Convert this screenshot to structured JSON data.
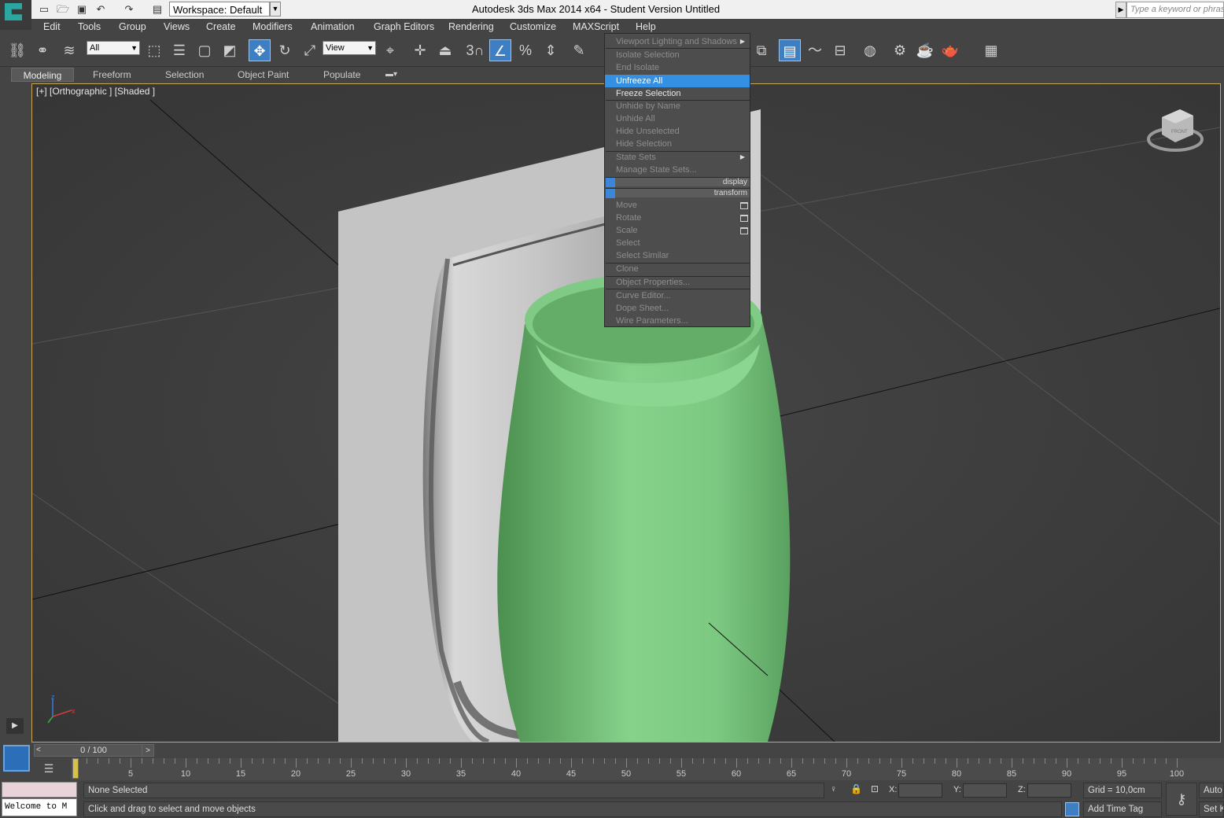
{
  "app": {
    "title": "Autodesk 3ds Max  2014 x64  - Student Version    Untitled",
    "workspace": "Workspace: Default",
    "search_placeholder": "Type a keyword or phrase"
  },
  "menubar": [
    "Edit",
    "Tools",
    "Group",
    "Views",
    "Create",
    "Modifiers",
    "Animation",
    "Graph Editors",
    "Rendering",
    "Customize",
    "MAXScript",
    "Help"
  ],
  "toolbar": {
    "selection_filter": "All",
    "ref_coord": "View",
    "snap_label": "3"
  },
  "ribbon_tabs": [
    "Modeling",
    "Freeform",
    "Selection",
    "Object Paint",
    "Populate"
  ],
  "viewport": {
    "label": "[+] [Orthographic ] [Shaded ]",
    "viewcube_label": "FRONT",
    "axis_labels": {
      "z": "z",
      "x": "x",
      "y": "y"
    }
  },
  "context_menu": {
    "items": [
      {
        "label": "Viewport Lighting and Shadows",
        "state": "disabled",
        "submenu": true
      },
      {
        "label": "Isolate Selection",
        "state": "disabled"
      },
      {
        "label": "End Isolate",
        "state": "disabled"
      },
      {
        "label": "Unfreeze All",
        "state": "selected"
      },
      {
        "label": "Freeze Selection",
        "state": "enabled"
      },
      {
        "label": "Unhide by Name",
        "state": "disabled"
      },
      {
        "label": "Unhide All",
        "state": "disabled"
      },
      {
        "label": "Hide Unselected",
        "state": "disabled"
      },
      {
        "label": "Hide Selection",
        "state": "disabled"
      },
      {
        "label": "State Sets",
        "state": "disabled",
        "submenu": true
      },
      {
        "label": "Manage State Sets...",
        "state": "disabled"
      },
      {
        "label": "Move",
        "state": "disabled"
      },
      {
        "label": "Rotate",
        "state": "disabled"
      },
      {
        "label": "Scale",
        "state": "disabled"
      },
      {
        "label": "Select",
        "state": "disabled"
      },
      {
        "label": "Select Similar",
        "state": "disabled"
      },
      {
        "label": "Clone",
        "state": "disabled"
      },
      {
        "label": "Object Properties...",
        "state": "disabled"
      },
      {
        "label": "Curve Editor...",
        "state": "disabled"
      },
      {
        "label": "Dope Sheet...",
        "state": "disabled"
      },
      {
        "label": "Wire Parameters...",
        "state": "disabled"
      }
    ],
    "quad_headers": [
      "display",
      "transform"
    ]
  },
  "timeline": {
    "slider_label": "0 / 100",
    "tick_labels": [
      "5",
      "10",
      "15",
      "20",
      "25",
      "30",
      "35",
      "40",
      "45",
      "50",
      "55",
      "60",
      "65",
      "70",
      "75",
      "80",
      "85",
      "90",
      "95",
      "100"
    ]
  },
  "status": {
    "selection": "None Selected",
    "prompt": "Click and drag to select and move objects",
    "maxscript_listener": "Welcome to M",
    "x_label": "X:",
    "y_label": "Y:",
    "z_label": "Z:",
    "grid": "Grid = 10,0cm",
    "add_time_tag": "Add Time Tag",
    "auto_key": "Auto",
    "set_key": "Set K"
  },
  "colors": {
    "accent": "#3390e3",
    "viewport_border": "#c8a75a",
    "vase": "#7ccb82"
  }
}
